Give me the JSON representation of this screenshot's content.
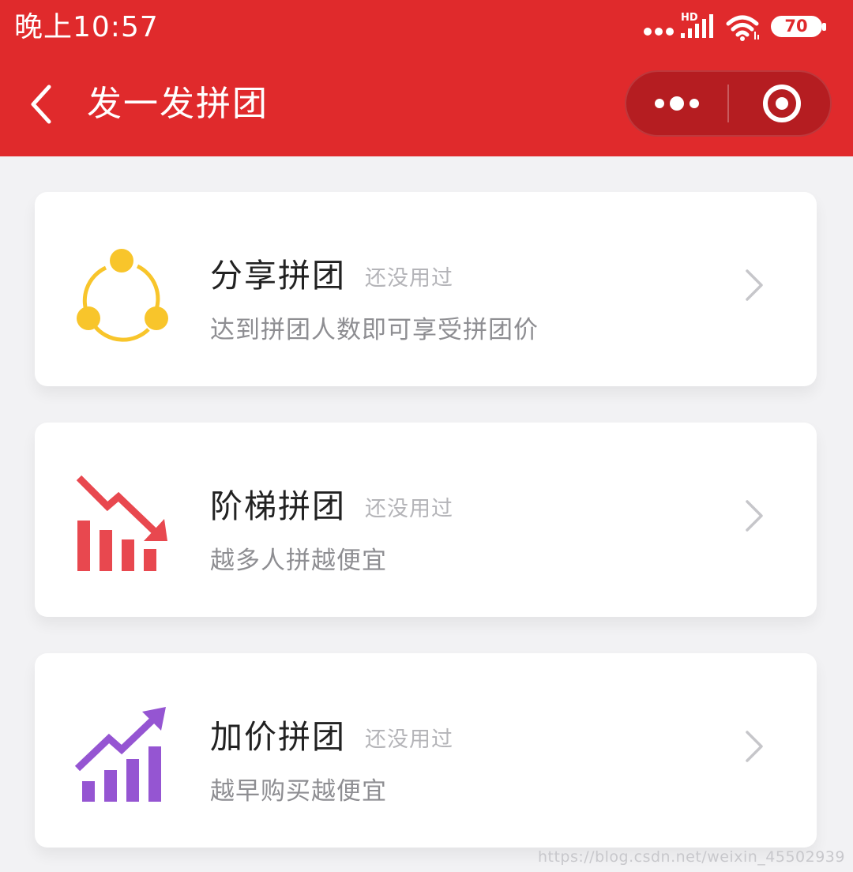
{
  "status_bar": {
    "time": "晚上10:57",
    "network": "HD",
    "battery": "70"
  },
  "nav": {
    "title": "发一发拼团",
    "back_icon": "chevron-left-icon",
    "more_icon": "more-dots-icon",
    "close_icon": "target-close-icon"
  },
  "cards": [
    {
      "title": "分享拼团",
      "tag": "还没用过",
      "desc": "达到拼团人数即可享受拼团价",
      "icon": "share-icon",
      "color": "#f8c52b"
    },
    {
      "title": "阶梯拼团",
      "tag": "还没用过",
      "desc": "越多人拼越便宜",
      "icon": "descending-chart-icon",
      "color": "#e8484f"
    },
    {
      "title": "加价拼团",
      "tag": "还没用过",
      "desc": "越早购买越便宜",
      "icon": "ascending-chart-icon",
      "color": "#9555d2"
    }
  ],
  "watermark": "https://blog.csdn.net/weixin_45502939",
  "colors": {
    "header": "#e02a2c",
    "background": "#f2f2f4"
  }
}
